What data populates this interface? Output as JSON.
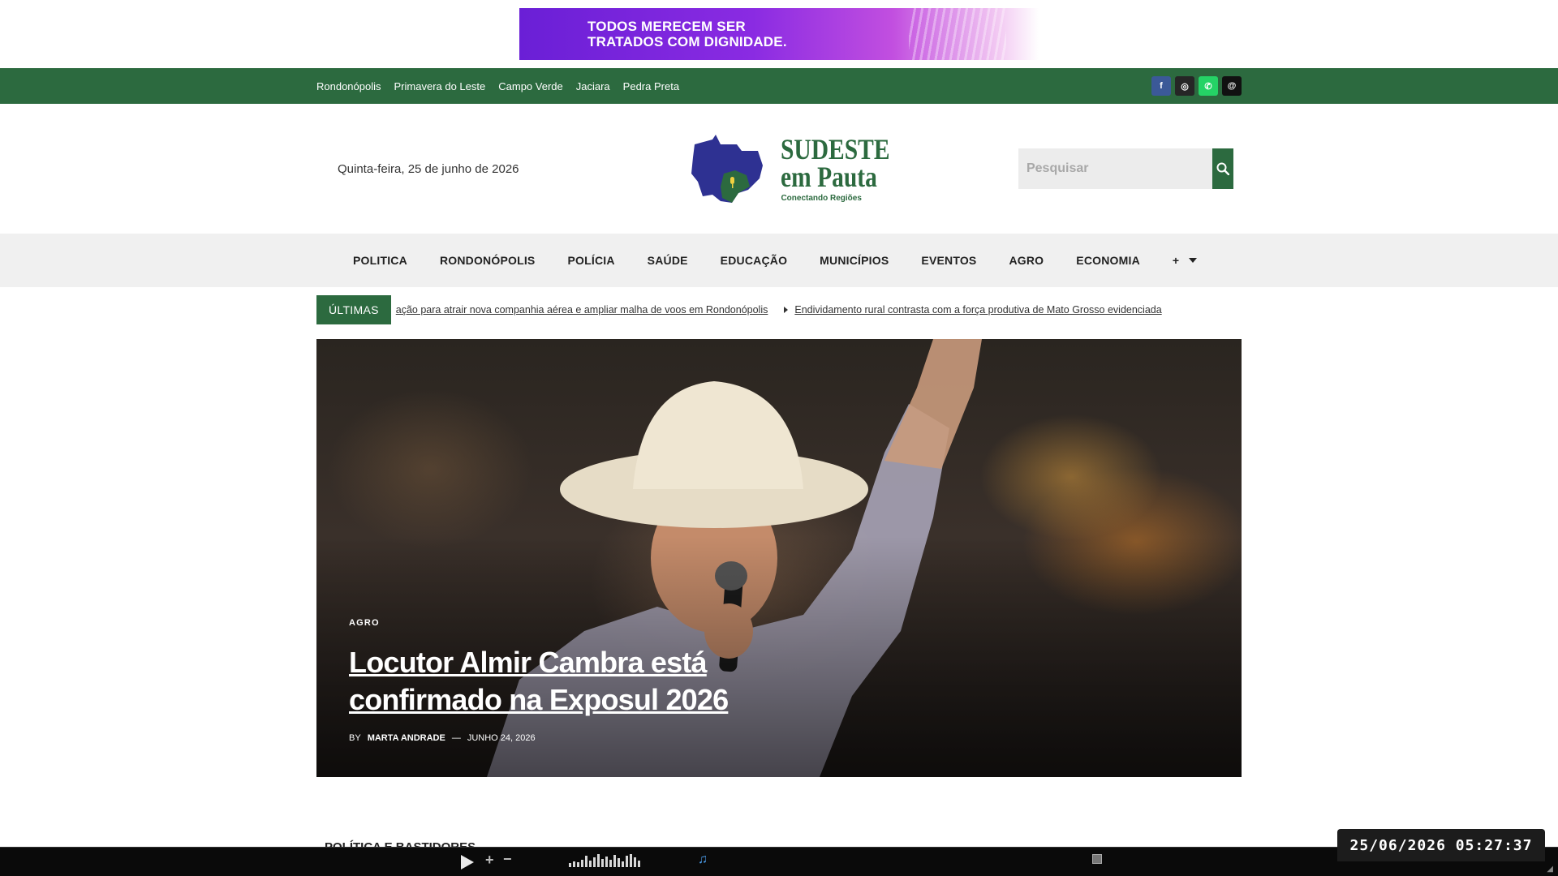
{
  "ad": {
    "line1": "TODOS MERECEM SER",
    "line2": "TRATADOS COM DIGNIDADE."
  },
  "cities": [
    "Rondonópolis",
    "Primavera do Leste",
    "Campo Verde",
    "Jaciara",
    "Pedra Preta"
  ],
  "social": [
    {
      "name": "facebook-icon",
      "glyph": "f"
    },
    {
      "name": "instagram-icon",
      "glyph": "◎"
    },
    {
      "name": "whatsapp-icon",
      "glyph": "✆"
    },
    {
      "name": "threads-icon",
      "glyph": "@"
    }
  ],
  "header": {
    "date": "Quinta-feira, 25 de junho de 2026",
    "logo_line1": "SUDESTE",
    "logo_line2": "em Pauta",
    "logo_tagline": "Conectando Regiões",
    "search_placeholder": "Pesquisar"
  },
  "nav": {
    "items": [
      "POLITICA",
      "RONDONÓPOLIS",
      "POLÍCIA",
      "SAÚDE",
      "EDUCAÇÃO",
      "MUNICÍPIOS",
      "EVENTOS",
      "AGRO",
      "ECONOMIA"
    ],
    "more_label": "+"
  },
  "ticker": {
    "label": "ÚLTIMAS",
    "items": [
      "ação para atrair nova companhia aérea e ampliar malha de voos em Rondonópolis",
      "Endividamento rural contrasta com a força produtiva de Mato Grosso evidenciada"
    ]
  },
  "hero": {
    "category": "AGRO",
    "title": "Locutor Almir Cambra está confirmado na Exposul 2026",
    "by": "BY",
    "author": "MARTA ANDRADE",
    "separator": "—",
    "date": "JUNHO 24, 2026"
  },
  "section": {
    "heading": "POLÍTICA E BASTIDORES"
  },
  "clock": {
    "text": "25/06/2026 05:27:37"
  },
  "colors": {
    "brand_green": "#2c6a3f",
    "nav_bg": "#f0f0f0",
    "ad_purple": "#8a2be2"
  }
}
